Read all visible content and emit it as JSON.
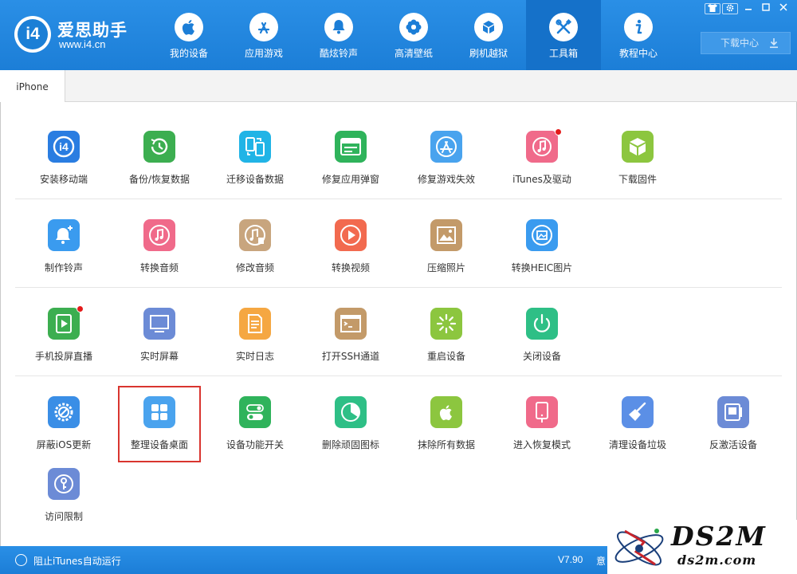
{
  "brand": {
    "logo_text": "i4",
    "name": "爱思助手",
    "url": "www.i4.cn"
  },
  "nav": {
    "items": [
      {
        "label": "我的设备",
        "icon": "apple-icon"
      },
      {
        "label": "应用游戏",
        "icon": "app-store-icon"
      },
      {
        "label": "酷炫铃声",
        "icon": "bell-icon"
      },
      {
        "label": "高清壁纸",
        "icon": "flower-icon"
      },
      {
        "label": "刷机越狱",
        "icon": "box-icon"
      },
      {
        "label": "工具箱",
        "icon": "tools-icon",
        "active": true
      },
      {
        "label": "教程中心",
        "icon": "info-icon"
      }
    ],
    "download_label": "下载中心"
  },
  "window_controls": [
    "shirt-icon",
    "gear-icon",
    "minimize-icon",
    "maximize-icon",
    "close-icon"
  ],
  "tabs": [
    {
      "label": "iPhone"
    }
  ],
  "tools": {
    "row1": [
      {
        "label": "安装移动端",
        "icon": "i4-icon",
        "color": "#2a7de1"
      },
      {
        "label": "备份/恢复数据",
        "icon": "backup-clock-icon",
        "color": "#3cae50"
      },
      {
        "label": "迁移设备数据",
        "icon": "migrate-phones-icon",
        "color": "#21b4e6"
      },
      {
        "label": "修复应用弹窗",
        "icon": "apple-id-icon",
        "color": "#2fb35b"
      },
      {
        "label": "修复游戏失效",
        "icon": "appstore-fix-icon",
        "color": "#49a3ee"
      },
      {
        "label": "iTunes及驱动",
        "icon": "itunes-icon",
        "color": "#f06a8a",
        "badge": true
      },
      {
        "label": "下载固件",
        "icon": "cube-icon",
        "color": "#8cc63f"
      }
    ],
    "row2": [
      {
        "label": "制作铃声",
        "icon": "bell-plus-icon",
        "color": "#3a9bef"
      },
      {
        "label": "转换音频",
        "icon": "music-note-icon",
        "color": "#f06a8a"
      },
      {
        "label": "修改音频",
        "icon": "audio-edit-icon",
        "color": "#c8a57e"
      },
      {
        "label": "转换视频",
        "icon": "video-play-icon",
        "color": "#f26a4f"
      },
      {
        "label": "压缩照片",
        "icon": "photo-icon",
        "color": "#c39a69"
      },
      {
        "label": "转换HEIC图片",
        "icon": "heic-icon",
        "color": "#3a9bef"
      }
    ],
    "row3": [
      {
        "label": "手机投屏直播",
        "icon": "screen-cast-icon",
        "color": "#3cae50",
        "badge": true
      },
      {
        "label": "实时屏幕",
        "icon": "monitor-icon",
        "color": "#6c8bd6"
      },
      {
        "label": "实时日志",
        "icon": "log-document-icon",
        "color": "#f5a742"
      },
      {
        "label": "打开SSH通道",
        "icon": "terminal-icon",
        "color": "#c39a69"
      },
      {
        "label": "重启设备",
        "icon": "restart-icon",
        "color": "#8cc63f"
      },
      {
        "label": "关闭设备",
        "icon": "power-icon",
        "color": "#2ebf86"
      }
    ],
    "row4": [
      {
        "label": "屏蔽iOS更新",
        "icon": "block-update-icon",
        "color": "#3a8ee6"
      },
      {
        "label": "整理设备桌面",
        "icon": "grid-icon",
        "color": "#4aa3ee"
      },
      {
        "label": "设备功能开关",
        "icon": "toggle-icon",
        "color": "#2fb35b"
      },
      {
        "label": "删除顽固图标",
        "icon": "pie-icon",
        "color": "#2ebf86"
      },
      {
        "label": "抹除所有数据",
        "icon": "apple-erase-icon",
        "color": "#8cc63f"
      },
      {
        "label": "进入恢复模式",
        "icon": "recovery-phone-icon",
        "color": "#f06a8a"
      },
      {
        "label": "清理设备垃圾",
        "icon": "broom-icon",
        "color": "#5b8fe6"
      },
      {
        "label": "反激活设备",
        "icon": "deactivate-icon",
        "color": "#6c8bd6"
      }
    ],
    "row5": [
      {
        "label": "访问限制",
        "icon": "key-lock-icon",
        "color": "#6c8bd6"
      }
    ]
  },
  "statusbar": {
    "itunes_toggle_label": "阻止iTunes自动运行",
    "version": "V7.90",
    "trailing_text": "意"
  },
  "watermark": {
    "main": "DS2M",
    "sub": "ds2m.com"
  }
}
